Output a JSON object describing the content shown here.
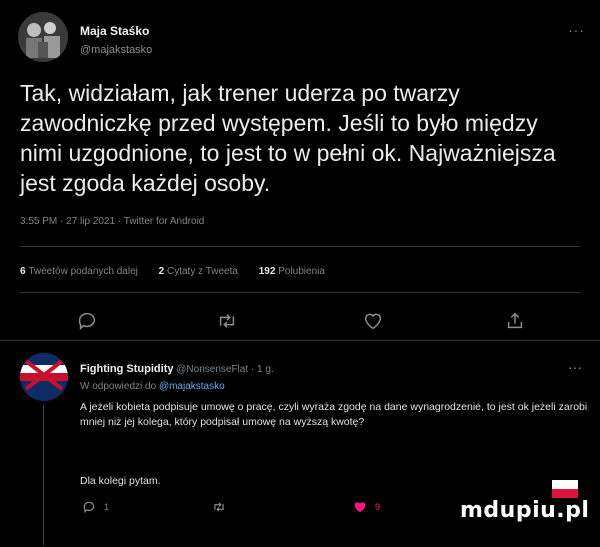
{
  "author": {
    "name": "Maja Staśko",
    "handle": "@majakstasko"
  },
  "tweet": {
    "text": "Tak, widziałam, jak trener uderza po twarzy zawodniczkę przed występem. Jeśli to było między nimi uzgodnione, to jest to w pełni ok. Najważniejsza jest zgoda każdej osoby.",
    "meta": "3:55 PM · 27 lip 2021 · Twitter for Android"
  },
  "stats": {
    "retweets_count": "6",
    "retweets_label": "Tweetów podanych dalej",
    "quotes_count": "2",
    "quotes_label": "Cytaty z Tweeta",
    "likes_count": "192",
    "likes_label": "Polubienia"
  },
  "reply": {
    "name": "Fighting Stupidity",
    "handle_time": "@NonsenseFlat · 1 g.",
    "reply_prefix": "W odpowiedzi do",
    "reply_mention": "@majakstasko",
    "text": "A jeżeli kobieta podpisuje umowę o pracę, czyli wyraża zgodę na dane wynagrodzenie, to jest ok jeżeli zarobi mniej niż jej kolega, który podpisał umowę na wyższą kwotę?",
    "text2": "Dla kolegi pytam.",
    "reply_count": "1",
    "like_count": "9",
    "like_color": "#f91880"
  },
  "watermark": "mdupiu.pl",
  "more_glyph": "···",
  "colors": {
    "background": "#000000",
    "text": "#e7e9ea",
    "muted": "#7f8489",
    "mention": "#6aa9f0",
    "divider": "#2f3336"
  }
}
